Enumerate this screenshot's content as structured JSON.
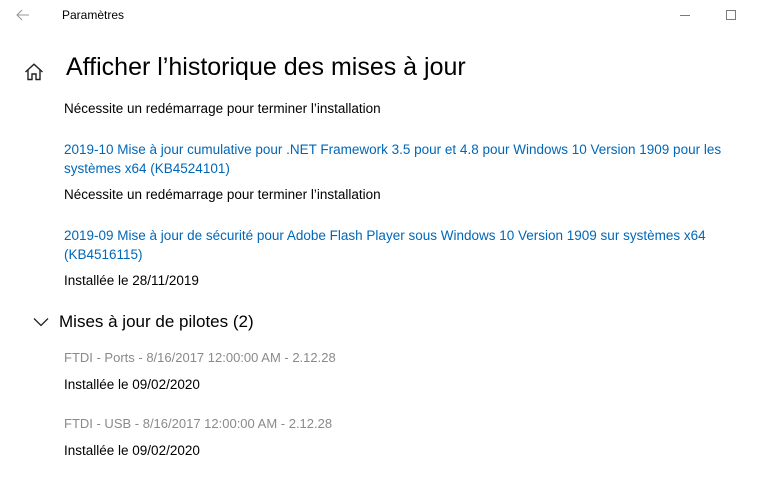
{
  "window": {
    "title": "Paramètres"
  },
  "header": {
    "title": "Afficher l’historique des mises à jour"
  },
  "quality_updates": {
    "items": [
      {
        "status": "Nécessite un redémarrage pour terminer l’installation"
      },
      {
        "name": "2019-10 Mise à jour cumulative pour .NET Framework 3.5 pour et 4.8 pour Windows 10 Version 1909 pour les systèmes x64 (KB4524101)",
        "status": "Nécessite un redémarrage pour terminer l’installation"
      },
      {
        "name": "2019-09 Mise à jour de sécurité pour Adobe Flash Player sous Windows 10 Version 1909 sur systèmes x64 (KB4516115)",
        "status": "Installée le 28/11/2019"
      }
    ]
  },
  "driver_updates": {
    "title": "Mises à jour de pilotes (2)",
    "items": [
      {
        "name": "FTDI - Ports - 8/16/2017 12:00:00 AM - 2.12.28",
        "status": "Installée le 09/02/2020"
      },
      {
        "name": "FTDI - USB - 8/16/2017 12:00:00 AM - 2.12.28",
        "status": "Installée le 09/02/2020"
      }
    ]
  },
  "icons": {
    "back": "back-arrow-icon",
    "minimize": "minimize-icon",
    "maximize": "maximize-icon",
    "home": "home-icon",
    "chevron": "chevron-down-icon"
  },
  "colors": {
    "link": "#0067b8",
    "driver_name": "#8a8a8a",
    "background": "#ffffff"
  }
}
